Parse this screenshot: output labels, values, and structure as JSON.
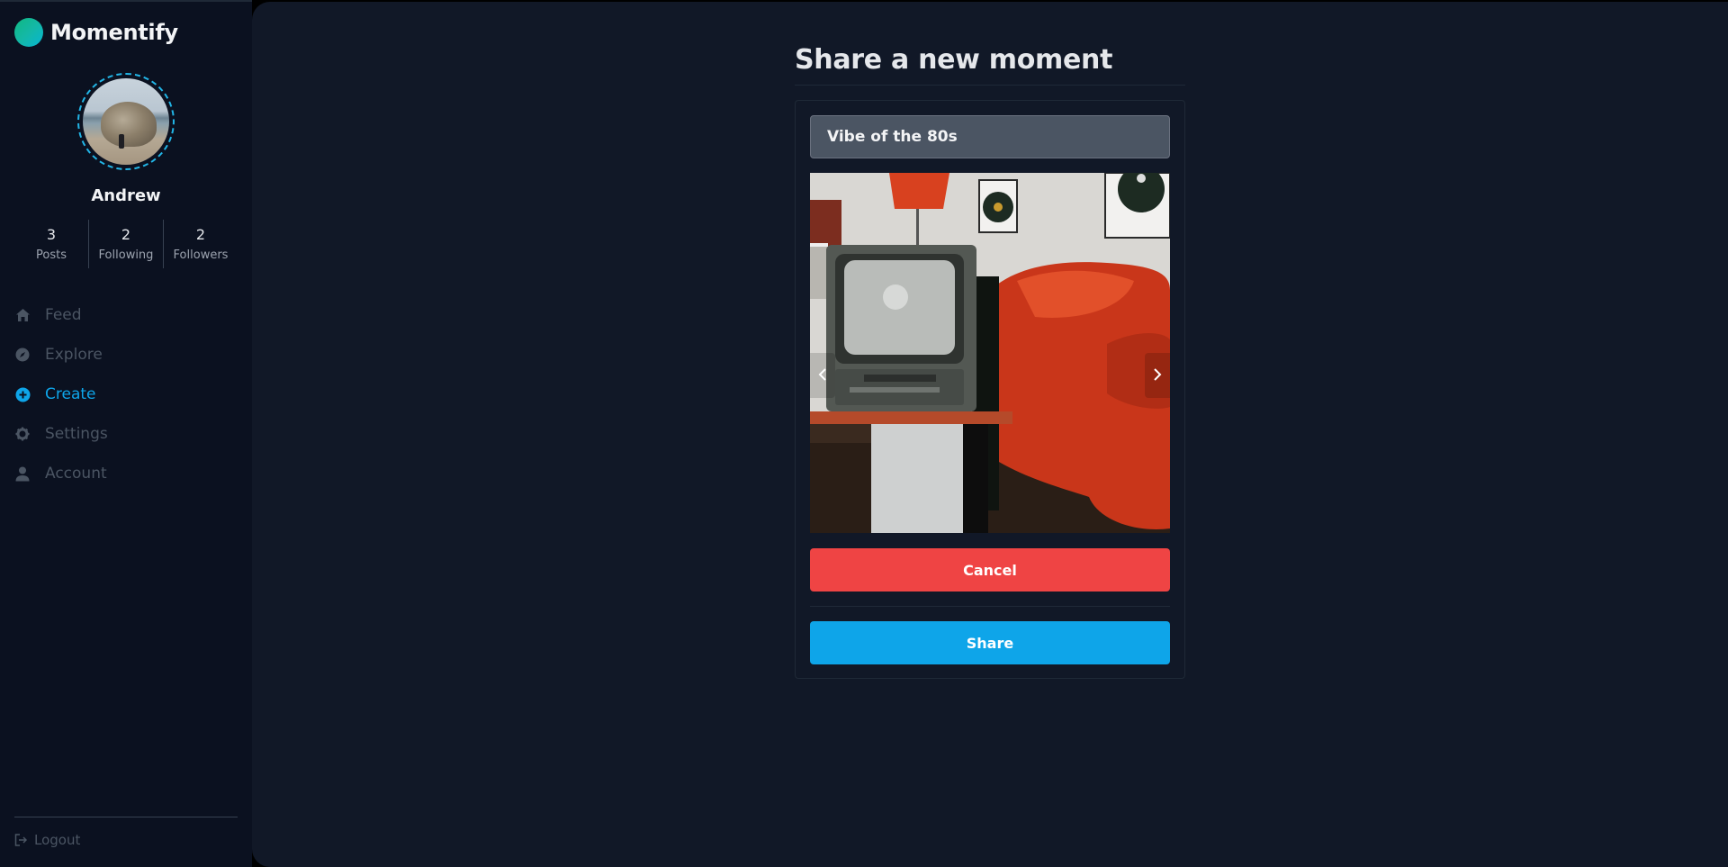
{
  "app": {
    "name": "Momentify"
  },
  "profile": {
    "name": "Andrew",
    "stats": [
      {
        "value": "3",
        "label": "Posts"
      },
      {
        "value": "2",
        "label": "Following"
      },
      {
        "value": "2",
        "label": "Followers"
      }
    ]
  },
  "nav": {
    "items": [
      {
        "label": "Feed",
        "icon": "home-icon"
      },
      {
        "label": "Explore",
        "icon": "compass-icon"
      },
      {
        "label": "Create",
        "icon": "plus-circle-icon",
        "active": true
      },
      {
        "label": "Settings",
        "icon": "gear-icon"
      },
      {
        "label": "Account",
        "icon": "user-icon"
      }
    ],
    "logout_label": "Logout"
  },
  "page": {
    "title": "Share a new moment",
    "caption_value": "Vibe of the 80s",
    "cancel_label": "Cancel",
    "share_label": "Share",
    "prev_icon": "chevron-left-icon",
    "next_icon": "chevron-right-icon"
  },
  "colors": {
    "accent": "#0ea5e9",
    "danger": "#ef4444",
    "sidebar_bg": "#0b1120",
    "main_bg": "#111827"
  }
}
